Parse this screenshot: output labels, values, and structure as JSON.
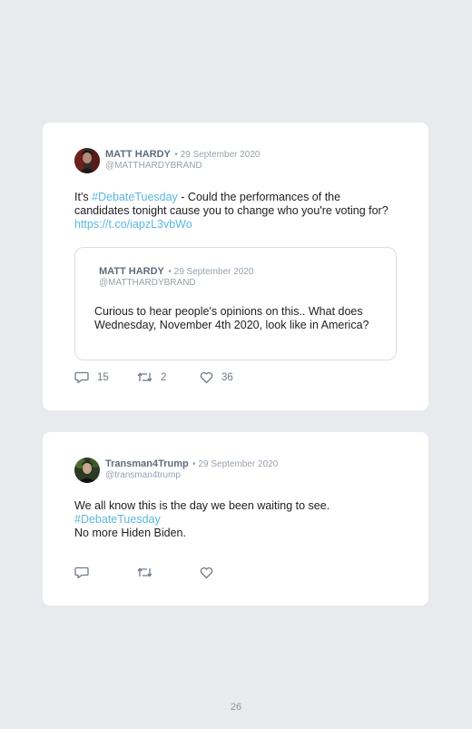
{
  "tweets": [
    {
      "author_name": "MATT HARDY",
      "date": "• 29 September 2020",
      "handle": "@MATTHARDYBRAND",
      "text_prefix": "It's ",
      "hashtag": "#DebateTuesday",
      "text_middle": " - Could the performances of the candidates tonight cause you to change who you're voting for? ",
      "url": "https://t.co/iapzL3vbWo",
      "quoted": {
        "author_name": "MATT HARDY",
        "date": "• 29 September 2020",
        "handle": "@MATTHARDYBRAND",
        "text": "Curious to hear people's opinions on this.. What does Wednesday, November 4th 2020, look like in America?"
      },
      "replies": "15",
      "retweets": "2",
      "likes": "36"
    },
    {
      "author_name": "Transman4Trump",
      "date": "• 29 September 2020",
      "handle": "@transman4trump",
      "line1": "We all know this is the day we been waiting to see.",
      "hashtag": "#DebateTuesday",
      "line3": "No more Hiden Biden."
    }
  ],
  "page_number": "26",
  "colors": {
    "link": "#5bb7dd",
    "background": "#e9eaee",
    "card": "#ffffff"
  },
  "icons": [
    "reply-icon",
    "retweet-icon",
    "like-icon"
  ]
}
